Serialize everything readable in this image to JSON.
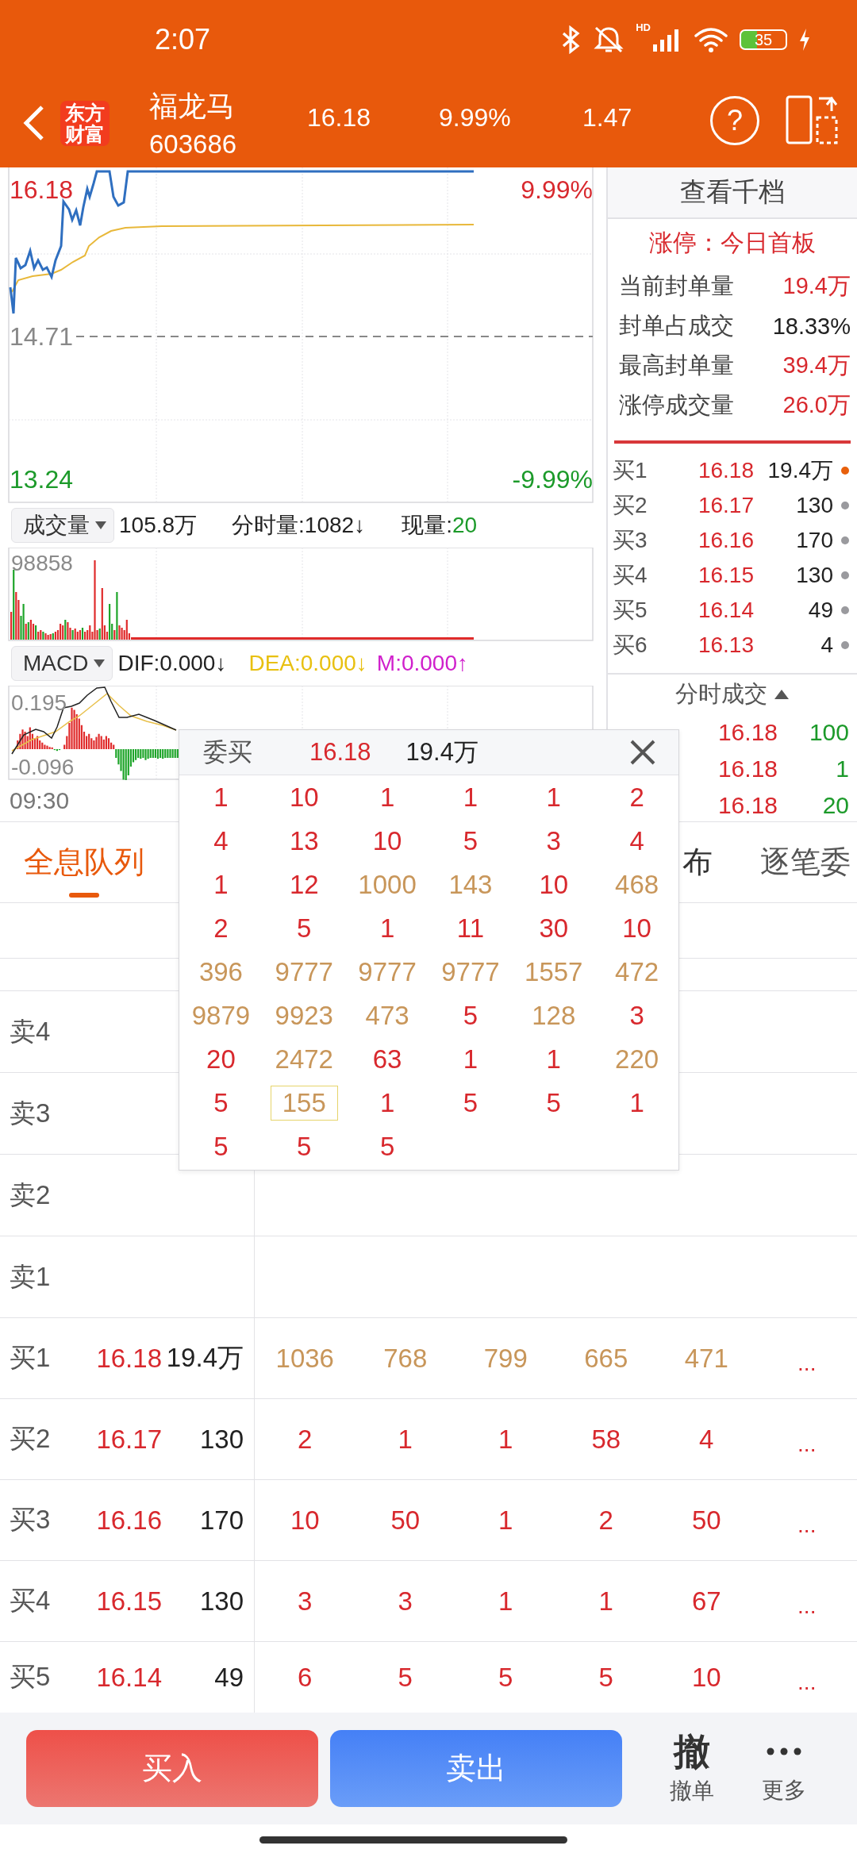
{
  "status_bar": {
    "time": "2:07",
    "network": "HD",
    "battery": "35"
  },
  "header": {
    "logo": "东方财富",
    "name": "福龙马",
    "code": "603686",
    "price": "16.18",
    "change_pct": "9.99%",
    "change": "1.47",
    "help": "?"
  },
  "price_chart": {
    "high_price": "16.18",
    "high_pct": "9.99%",
    "prev_close": "14.71",
    "low_price": "13.24",
    "low_pct": "-9.99%"
  },
  "volume_bar": {
    "selector": "成交量",
    "total": "105.8万",
    "tick_volume": "分时量:1082↓",
    "current_label": "现量:",
    "current_value": "20"
  },
  "volume_chart": {
    "max_label": "98858"
  },
  "macd_bar": {
    "selector": "MACD",
    "dif": "DIF:0.000↓",
    "dea": "DEA:0.000↓",
    "m": "M:0.000↑"
  },
  "macd_chart": {
    "top_label": "0.195",
    "bottom_label": "-0.096"
  },
  "time_axis": {
    "start": "09:30"
  },
  "level2_panel": {
    "title": "查看千档",
    "limit_status": "涨停：今日首板",
    "stats": [
      {
        "label": "当前封单量",
        "value": "19.4万",
        "color": "#d8282d"
      },
      {
        "label": "封单占成交",
        "value": "18.33%",
        "color": "#222222"
      },
      {
        "label": "最高封单量",
        "value": "39.4万",
        "color": "#d8282d"
      },
      {
        "label": "涨停成交量",
        "value": "26.0万",
        "color": "#d8282d"
      }
    ],
    "bids": [
      {
        "label": "买1",
        "price": "16.18",
        "volume": "19.4万",
        "color": "#e8600c"
      },
      {
        "label": "买2",
        "price": "16.17",
        "volume": "130",
        "color": "#9a9a9e"
      },
      {
        "label": "买3",
        "price": "16.16",
        "volume": "170",
        "color": "#9a9a9e"
      },
      {
        "label": "买4",
        "price": "16.15",
        "volume": "130",
        "color": "#9a9a9e"
      },
      {
        "label": "买5",
        "price": "16.14",
        "volume": "49",
        "color": "#9a9a9e"
      },
      {
        "label": "买6",
        "price": "16.13",
        "volume": "4",
        "color": "#9a9a9e"
      }
    ],
    "trades_title": "分时成交",
    "trades": [
      {
        "price": "16.18",
        "volume": "100"
      },
      {
        "price": "16.18",
        "volume": "1"
      },
      {
        "price": "16.18",
        "volume": "20"
      }
    ]
  },
  "tabs": [
    {
      "label": "全息队列",
      "selected": true
    },
    {
      "label": "布",
      "selected": false
    },
    {
      "label": "逐笔委",
      "selected": false
    }
  ],
  "queue_table": {
    "asks": [
      {
        "label": "卖4"
      },
      {
        "label": "卖3"
      },
      {
        "label": "卖2"
      },
      {
        "label": "卖1"
      }
    ],
    "bids": [
      {
        "label": "买1",
        "price": "16.18",
        "volume": "19.4万",
        "more": "...",
        "queue": [
          {
            "text": "1036",
            "large": true
          },
          {
            "text": "768",
            "large": true
          },
          {
            "text": "799",
            "large": true
          },
          {
            "text": "665",
            "large": true
          },
          {
            "text": "471",
            "large": true
          }
        ]
      },
      {
        "label": "买2",
        "price": "16.17",
        "volume": "130",
        "more": "...",
        "queue": [
          {
            "text": "2",
            "large": false
          },
          {
            "text": "1",
            "large": false
          },
          {
            "text": "1",
            "large": false
          },
          {
            "text": "58",
            "large": false
          },
          {
            "text": "4",
            "large": false
          }
        ]
      },
      {
        "label": "买3",
        "price": "16.16",
        "volume": "170",
        "more": "...",
        "queue": [
          {
            "text": "10",
            "large": false
          },
          {
            "text": "50",
            "large": false
          },
          {
            "text": "1",
            "large": false
          },
          {
            "text": "2",
            "large": false
          },
          {
            "text": "50",
            "large": false
          }
        ]
      },
      {
        "label": "买4",
        "price": "16.15",
        "volume": "130",
        "more": "...",
        "queue": [
          {
            "text": "3",
            "large": false
          },
          {
            "text": "3",
            "large": false
          },
          {
            "text": "1",
            "large": false
          },
          {
            "text": "1",
            "large": false
          },
          {
            "text": "67",
            "large": false
          }
        ]
      },
      {
        "label": "买5",
        "price": "16.14",
        "volume": "49",
        "more": "...",
        "queue": [
          {
            "text": "6",
            "large": false
          },
          {
            "text": "5",
            "large": false
          },
          {
            "text": "5",
            "large": false
          },
          {
            "text": "5",
            "large": false
          },
          {
            "text": "10",
            "large": false
          }
        ]
      }
    ]
  },
  "order_popup": {
    "title": "委买",
    "price": "16.18",
    "volume": "19.4万",
    "rows": [
      [
        {
          "text": "1",
          "large": false,
          "selected": false
        },
        {
          "text": "10",
          "large": false,
          "selected": false
        },
        {
          "text": "1",
          "large": false,
          "selected": false
        },
        {
          "text": "1",
          "large": false,
          "selected": false
        },
        {
          "text": "1",
          "large": false,
          "selected": false
        },
        {
          "text": "2",
          "large": false,
          "selected": false
        }
      ],
      [
        {
          "text": "4",
          "large": false,
          "selected": false
        },
        {
          "text": "13",
          "large": false,
          "selected": false
        },
        {
          "text": "10",
          "large": false,
          "selected": false
        },
        {
          "text": "5",
          "large": false,
          "selected": false
        },
        {
          "text": "3",
          "large": false,
          "selected": false
        },
        {
          "text": "4",
          "large": false,
          "selected": false
        }
      ],
      [
        {
          "text": "1",
          "large": false,
          "selected": false
        },
        {
          "text": "12",
          "large": false,
          "selected": false
        },
        {
          "text": "1000",
          "large": true,
          "selected": false
        },
        {
          "text": "143",
          "large": true,
          "selected": false
        },
        {
          "text": "10",
          "large": false,
          "selected": false
        },
        {
          "text": "468",
          "large": true,
          "selected": false
        }
      ],
      [
        {
          "text": "2",
          "large": false,
          "selected": false
        },
        {
          "text": "5",
          "large": false,
          "selected": false
        },
        {
          "text": "1",
          "large": false,
          "selected": false
        },
        {
          "text": "11",
          "large": false,
          "selected": false
        },
        {
          "text": "30",
          "large": false,
          "selected": false
        },
        {
          "text": "10",
          "large": false,
          "selected": false
        }
      ],
      [
        {
          "text": "396",
          "large": true,
          "selected": false
        },
        {
          "text": "9777",
          "large": true,
          "selected": false
        },
        {
          "text": "9777",
          "large": true,
          "selected": false
        },
        {
          "text": "9777",
          "large": true,
          "selected": false
        },
        {
          "text": "1557",
          "large": true,
          "selected": false
        },
        {
          "text": "472",
          "large": true,
          "selected": false
        }
      ],
      [
        {
          "text": "9879",
          "large": true,
          "selected": false
        },
        {
          "text": "9923",
          "large": true,
          "selected": false
        },
        {
          "text": "473",
          "large": true,
          "selected": false
        },
        {
          "text": "5",
          "large": false,
          "selected": false
        },
        {
          "text": "128",
          "large": true,
          "selected": false
        },
        {
          "text": "3",
          "large": false,
          "selected": false
        }
      ],
      [
        {
          "text": "20",
          "large": false,
          "selected": false
        },
        {
          "text": "2472",
          "large": true,
          "selected": false
        },
        {
          "text": "63",
          "large": false,
          "selected": false
        },
        {
          "text": "1",
          "large": false,
          "selected": false
        },
        {
          "text": "1",
          "large": false,
          "selected": false
        },
        {
          "text": "220",
          "large": true,
          "selected": false
        }
      ],
      [
        {
          "text": "5",
          "large": false,
          "selected": false
        },
        {
          "text": "155",
          "large": true,
          "selected": true
        },
        {
          "text": "1",
          "large": false,
          "selected": false
        },
        {
          "text": "5",
          "large": false,
          "selected": false
        },
        {
          "text": "5",
          "large": false,
          "selected": false
        },
        {
          "text": "1",
          "large": false,
          "selected": false
        }
      ],
      [
        {
          "text": "5",
          "large": false,
          "selected": false
        },
        {
          "text": "5",
          "large": false,
          "selected": false
        },
        {
          "text": "5",
          "large": false,
          "selected": false
        }
      ]
    ]
  },
  "bottom_bar": {
    "buy": "买入",
    "sell": "卖出",
    "cancel_glyph": "撤",
    "cancel": "撤单",
    "more": "更多"
  }
}
